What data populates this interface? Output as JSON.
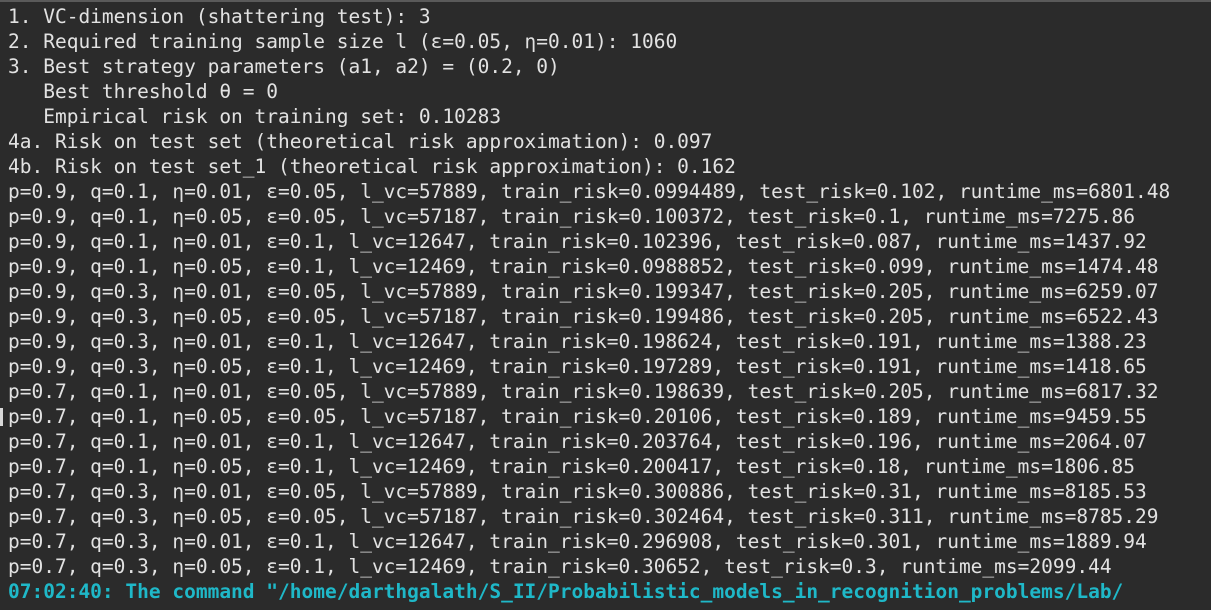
{
  "terminal": {
    "lines": [
      "1. VC-dimension (shattering test): 3",
      "2. Required training sample size l (ε=0.05, η=0.01): 1060",
      "3. Best strategy parameters (a1, a2) = (0.2, 0)",
      "   Best threshold θ = 0",
      "   Empirical risk on training set: 0.10283",
      "4a. Risk on test set (theoretical risk approximation): 0.097",
      "4b. Risk on test set_1 (theoretical risk approximation): 0.162",
      "p=0.9, q=0.1, η=0.01, ε=0.05, l_vc=57889, train_risk=0.0994489, test_risk=0.102, runtime_ms=6801.48",
      "p=0.9, q=0.1, η=0.05, ε=0.05, l_vc=57187, train_risk=0.100372, test_risk=0.1, runtime_ms=7275.86",
      "p=0.9, q=0.1, η=0.01, ε=0.1, l_vc=12647, train_risk=0.102396, test_risk=0.087, runtime_ms=1437.92",
      "p=0.9, q=0.1, η=0.05, ε=0.1, l_vc=12469, train_risk=0.0988852, test_risk=0.099, runtime_ms=1474.48",
      "p=0.9, q=0.3, η=0.01, ε=0.05, l_vc=57889, train_risk=0.199347, test_risk=0.205, runtime_ms=6259.07",
      "p=0.9, q=0.3, η=0.05, ε=0.05, l_vc=57187, train_risk=0.199486, test_risk=0.205, runtime_ms=6522.43",
      "p=0.9, q=0.3, η=0.01, ε=0.1, l_vc=12647, train_risk=0.198624, test_risk=0.191, runtime_ms=1388.23",
      "p=0.9, q=0.3, η=0.05, ε=0.1, l_vc=12469, train_risk=0.197289, test_risk=0.191, runtime_ms=1418.65",
      "p=0.7, q=0.1, η=0.01, ε=0.05, l_vc=57889, train_risk=0.198639, test_risk=0.205, runtime_ms=6817.32",
      "p=0.7, q=0.1, η=0.05, ε=0.05, l_vc=57187, train_risk=0.20106, test_risk=0.189, runtime_ms=9459.55",
      "p=0.7, q=0.1, η=0.01, ε=0.1, l_vc=12647, train_risk=0.203764, test_risk=0.196, runtime_ms=2064.07",
      "p=0.7, q=0.1, η=0.05, ε=0.1, l_vc=12469, train_risk=0.200417, test_risk=0.18, runtime_ms=1806.85",
      "p=0.7, q=0.3, η=0.01, ε=0.05, l_vc=57889, train_risk=0.300886, test_risk=0.31, runtime_ms=8185.53",
      "p=0.7, q=0.3, η=0.05, ε=0.05, l_vc=57187, train_risk=0.302464, test_risk=0.311, runtime_ms=8785.29",
      "p=0.7, q=0.3, η=0.01, ε=0.1, l_vc=12647, train_risk=0.296908, test_risk=0.301, runtime_ms=1889.94",
      "p=0.7, q=0.3, η=0.05, ε=0.1, l_vc=12469, train_risk=0.30652, test_risk=0.3, runtime_ms=2099.44"
    ],
    "status_line": "07:02:40: The command \"/home/darthgalath/S_II/Probabilistic_models_in_recognition_problems/Lab/",
    "colors": {
      "background": "#2b2b2b",
      "text": "#e2e2e2",
      "status_accent": "#1fb8c8"
    }
  }
}
